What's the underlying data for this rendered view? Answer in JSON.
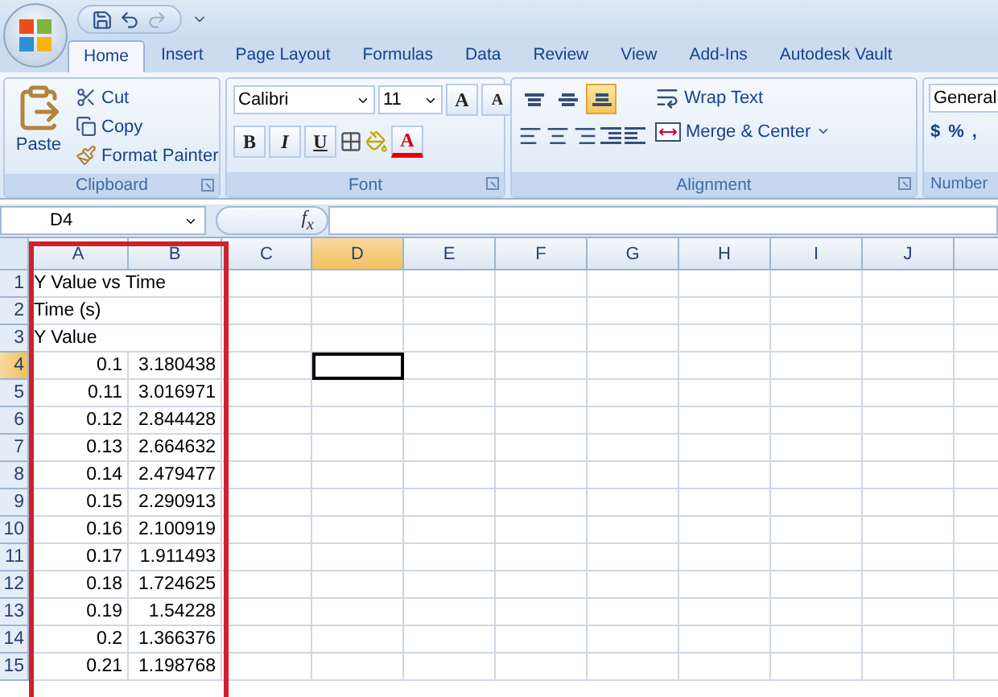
{
  "tabs": [
    {
      "label": "Home",
      "selected": true
    },
    {
      "label": "Insert",
      "selected": false
    },
    {
      "label": "Page Layout",
      "selected": false
    },
    {
      "label": "Formulas",
      "selected": false
    },
    {
      "label": "Data",
      "selected": false
    },
    {
      "label": "Review",
      "selected": false
    },
    {
      "label": "View",
      "selected": false
    },
    {
      "label": "Add-Ins",
      "selected": false
    },
    {
      "label": "Autodesk Vault",
      "selected": false
    }
  ],
  "ribbon": {
    "clipboard": {
      "paste": "Paste",
      "cut": "Cut",
      "copy": "Copy",
      "format_painter": "Format Painter",
      "label": "Clipboard"
    },
    "font": {
      "name": "Calibri",
      "size": "11",
      "grow": "A",
      "shrink": "A",
      "bold": "B",
      "italic": "I",
      "underline": "U",
      "font_color": "A",
      "label": "Font"
    },
    "alignment": {
      "vertical_align": [
        {
          "selected": false
        },
        {
          "selected": false
        },
        {
          "selected": true
        }
      ],
      "wrap_text": "Wrap Text",
      "merge": "Merge & Center",
      "label": "Alignment"
    },
    "number": {
      "format": "General",
      "currency": "$",
      "percent": "%",
      "comma": ",",
      "label": "Number"
    }
  },
  "formula_bar": {
    "name_box": "D4",
    "function_label": "f$_{x}$"
  },
  "sheet": {
    "columns": [
      {
        "label": "A",
        "selected": false
      },
      {
        "label": "B",
        "selected": false
      },
      {
        "label": "C",
        "selected": false
      },
      {
        "label": "D",
        "selected": true
      },
      {
        "label": "E",
        "selected": false
      },
      {
        "label": "F",
        "selected": false
      },
      {
        "label": "G",
        "selected": false
      },
      {
        "label": "H",
        "selected": false
      },
      {
        "label": "I",
        "selected": false
      },
      {
        "label": "J",
        "selected": false
      }
    ],
    "rows": [
      {
        "number": "1",
        "kind": "text",
        "a": "Y Value vs Time",
        "selected": false
      },
      {
        "number": "2",
        "kind": "text",
        "a": "Time (s)",
        "selected": false
      },
      {
        "number": "3",
        "kind": "text",
        "a": "Y Value",
        "selected": false
      },
      {
        "number": "4",
        "kind": "values",
        "a": "0.1",
        "b": "3.180438",
        "selected": true
      },
      {
        "number": "5",
        "kind": "values",
        "a": "0.11",
        "b": "3.016971",
        "selected": false
      },
      {
        "number": "6",
        "kind": "values",
        "a": "0.12",
        "b": "2.844428",
        "selected": false
      },
      {
        "number": "7",
        "kind": "values",
        "a": "0.13",
        "b": "2.664632",
        "selected": false
      },
      {
        "number": "8",
        "kind": "values",
        "a": "0.14",
        "b": "2.479477",
        "selected": false
      },
      {
        "number": "9",
        "kind": "values",
        "a": "0.15",
        "b": "2.290913",
        "selected": false
      },
      {
        "number": "10",
        "kind": "values",
        "a": "0.16",
        "b": "2.100919",
        "selected": false
      },
      {
        "number": "11",
        "kind": "values",
        "a": "0.17",
        "b": "1.911493",
        "selected": false
      },
      {
        "number": "12",
        "kind": "values",
        "a": "0.18",
        "b": "1.724625",
        "selected": false
      },
      {
        "number": "13",
        "kind": "values",
        "a": "0.19",
        "b": "1.54228",
        "selected": false
      },
      {
        "number": "14",
        "kind": "values",
        "a": "0.2",
        "b": "1.366376",
        "selected": false
      },
      {
        "number": "15",
        "kind": "values",
        "a": "0.21",
        "b": "1.198768",
        "selected": false
      }
    ]
  }
}
